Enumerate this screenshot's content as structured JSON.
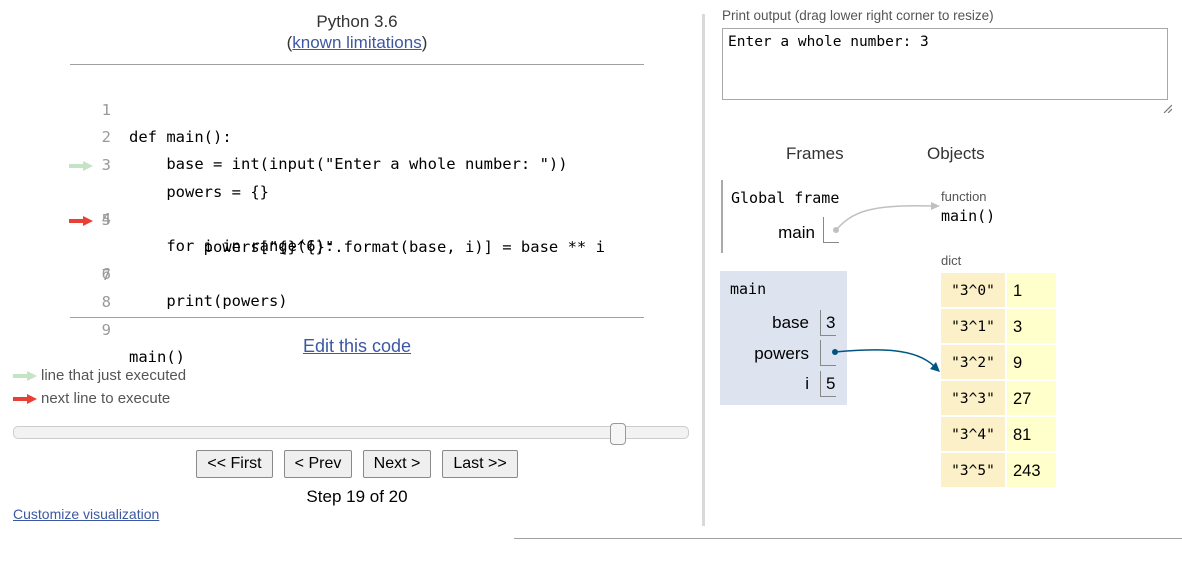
{
  "header": {
    "title": "Python 3.6",
    "sub_open": "(",
    "limitations_link": "known limitations",
    "sub_close": ")"
  },
  "code": {
    "lines": [
      {
        "num": "1",
        "text": "def main():"
      },
      {
        "num": "2",
        "text": "    base = int(input(\"Enter a whole number: \"))"
      },
      {
        "num": "3",
        "text": "    powers = {}"
      },
      {
        "num": "4",
        "text": "    for i in range(6):"
      },
      {
        "num": "5",
        "text": "        powers[\"{}^{}\".format(base, i)] = base ** i"
      },
      {
        "num": "6",
        "text": "    print(powers)"
      },
      {
        "num": "7",
        "text": ""
      },
      {
        "num": "8",
        "text": ""
      },
      {
        "num": "9",
        "text": "main()"
      }
    ],
    "just_executed_line": 4,
    "next_line": 6
  },
  "edit_link": "Edit this code",
  "legend": {
    "just_executed": "line that just executed",
    "next_line": "next line to execute"
  },
  "slider": {
    "step": 19,
    "total": 20
  },
  "nav": {
    "first": "<< First",
    "prev": "< Prev",
    "next": "Next >",
    "last": "Last >>"
  },
  "step_label": "Step 19 of 20",
  "customize_link": "Customize visualization",
  "output": {
    "label": "Print output (drag lower right corner to resize)",
    "text": "Enter a whole number: 3"
  },
  "viz": {
    "frames_heading": "Frames",
    "objects_heading": "Objects",
    "global_frame": {
      "title": "Global frame",
      "vars": [
        {
          "name": "main"
        }
      ]
    },
    "main_frame": {
      "title": "main",
      "vars": [
        {
          "name": "base",
          "value": "3"
        },
        {
          "name": "powers",
          "value": ""
        },
        {
          "name": "i",
          "value": "5"
        }
      ]
    },
    "function_object": {
      "type": "function",
      "name": "main()"
    },
    "dict_object": {
      "type": "dict",
      "entries": [
        {
          "key": "\"3^0\"",
          "value": "1"
        },
        {
          "key": "\"3^1\"",
          "value": "3"
        },
        {
          "key": "\"3^2\"",
          "value": "9"
        },
        {
          "key": "\"3^3\"",
          "value": "27"
        },
        {
          "key": "\"3^4\"",
          "value": "81"
        },
        {
          "key": "\"3^5\"",
          "value": "243"
        }
      ]
    }
  },
  "colors": {
    "link": "#3d58a2",
    "just_executed_arrow": "#c5e3c5",
    "next_line_arrow": "#e93f34",
    "frame_bg": "#dde4f0",
    "dict_key_bg": "#fbf0c7",
    "dict_value_bg": "#ffffcc",
    "pointer_active": "#005583",
    "pointer_inactive": "#c0c0c0"
  }
}
